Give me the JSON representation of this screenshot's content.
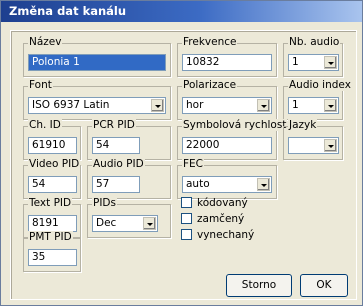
{
  "window": {
    "title": "Změna dat kanálu"
  },
  "fields": {
    "nazev": {
      "label": "Název",
      "value": "Polonia 1"
    },
    "frekvence": {
      "label": "Frekvence",
      "value": "10832"
    },
    "nb_audio": {
      "label": "Nb. audio",
      "value": "1"
    },
    "font": {
      "label": "Font",
      "value": "ISO 6937 Latin"
    },
    "polarizace": {
      "label": "Polarizace",
      "value": "hor"
    },
    "audio_index": {
      "label": "Audio index",
      "value": "1"
    },
    "ch_id": {
      "label": "Ch. ID",
      "value": "61910"
    },
    "pcr_pid": {
      "label": "PCR PID",
      "value": "54"
    },
    "symbol": {
      "label": "Symbolová rychlost",
      "value": "22000"
    },
    "jazyk": {
      "label": "Jazyk",
      "value": ""
    },
    "video_pid": {
      "label": "Video PID",
      "value": "54"
    },
    "audio_pid": {
      "label": "Audio PID",
      "value": "57"
    },
    "fec": {
      "label": "FEC",
      "value": "auto"
    },
    "text_pid": {
      "label": "Text PID",
      "value": "8191"
    },
    "pids": {
      "label": "PIDs",
      "value": "Dec"
    },
    "pmt_pid": {
      "label": "PMT PID",
      "value": "35"
    }
  },
  "checkboxes": {
    "kodovany": {
      "label": "kódovaný",
      "checked": false
    },
    "zamceny": {
      "label": "zamčený",
      "checked": false
    },
    "vynechany": {
      "label": "vynechaný",
      "checked": false
    }
  },
  "buttons": {
    "storno": "Storno",
    "ok": "OK"
  }
}
